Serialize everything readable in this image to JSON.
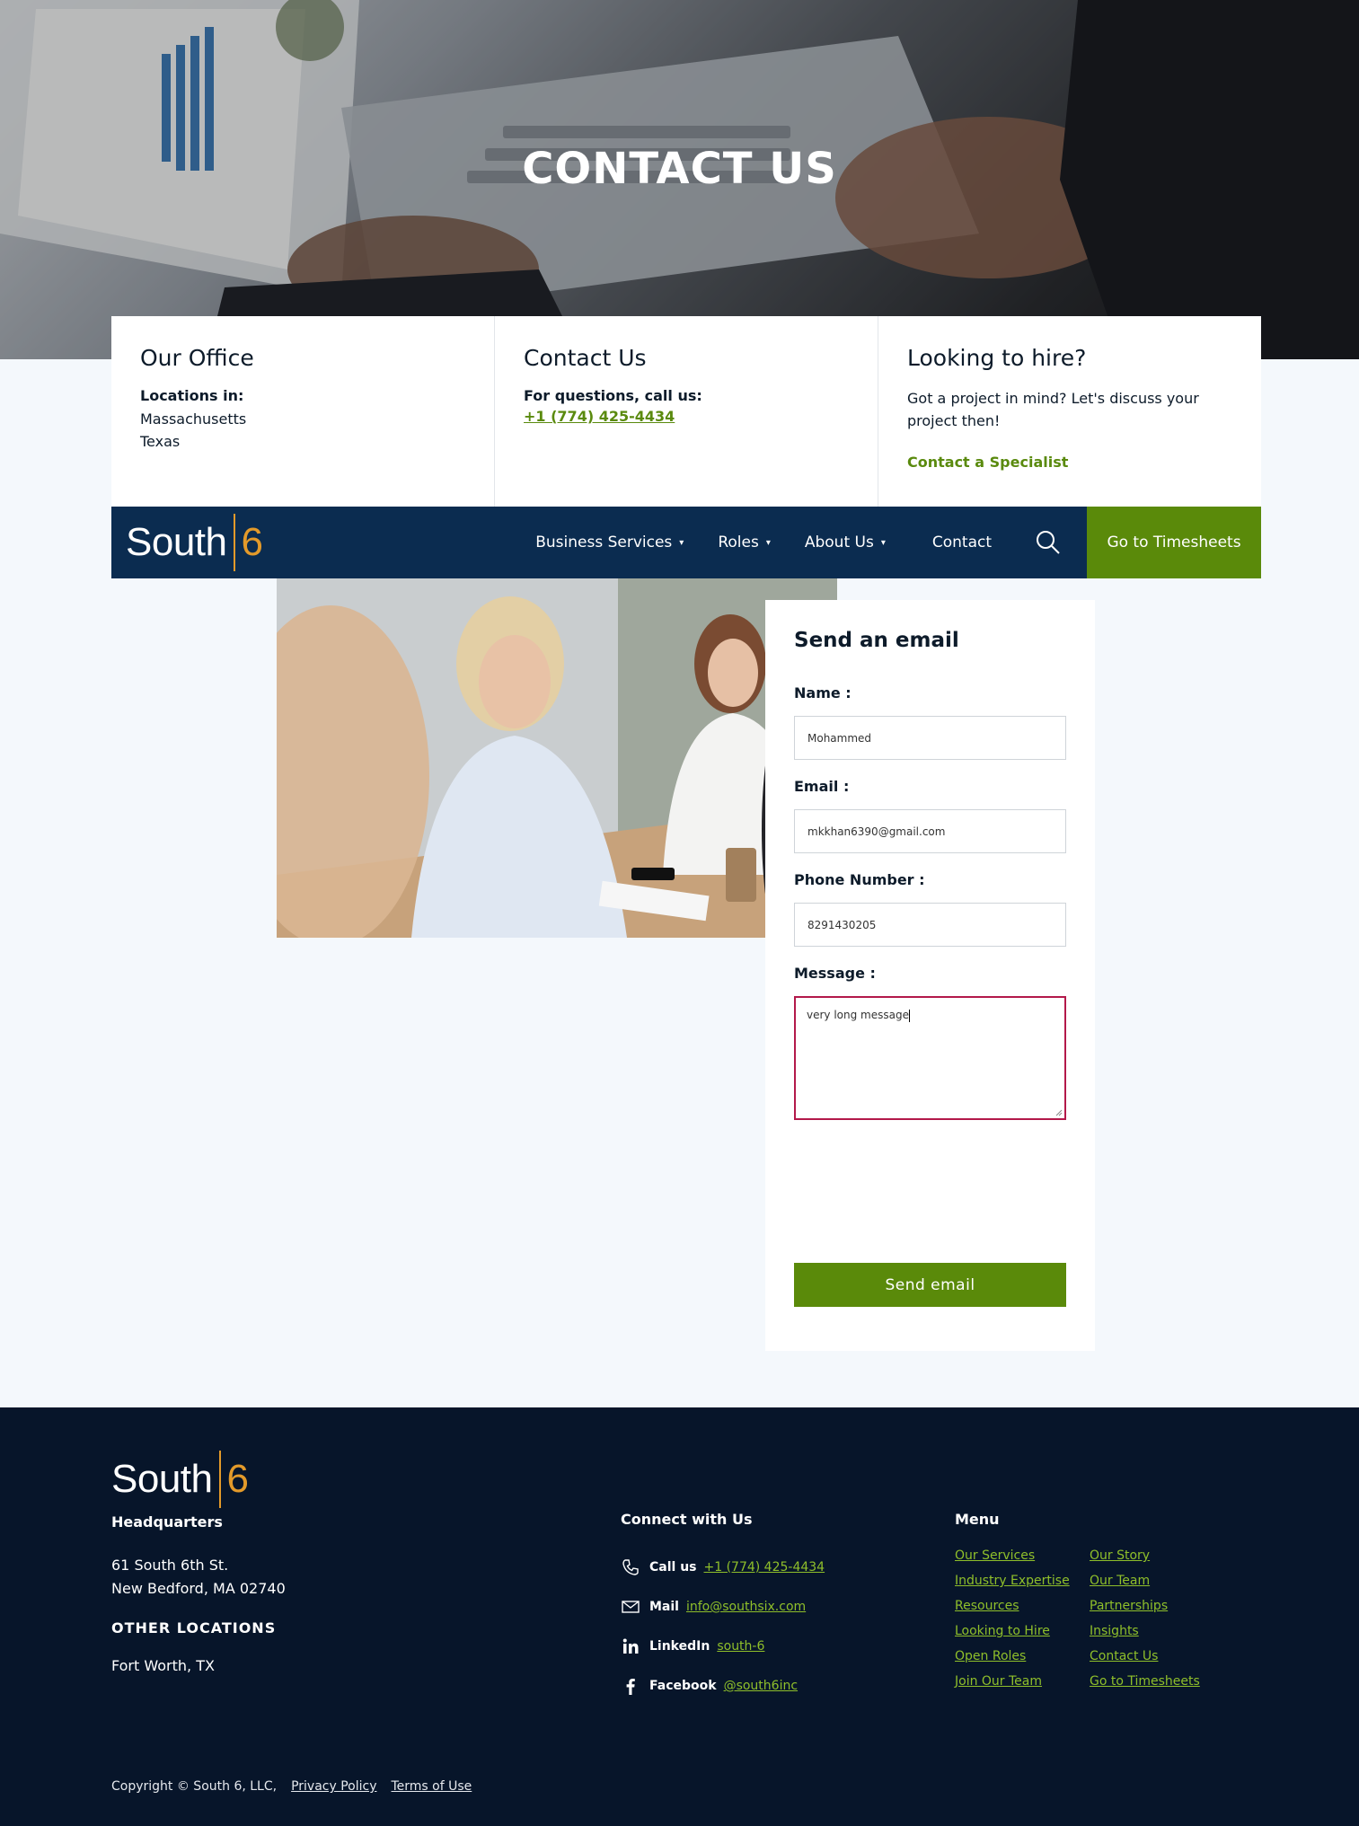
{
  "hero": {
    "title": "CONTACT US"
  },
  "cards": {
    "office": {
      "heading": "Our Office",
      "label": "Locations in:",
      "lines": [
        "Massachusetts",
        "Texas"
      ]
    },
    "contact": {
      "heading": "Contact Us",
      "label": "For questions, call us:",
      "phone": "+1 (774) 425-4434"
    },
    "hire": {
      "heading": "Looking to hire?",
      "text": "Got a project in mind? Let's discuss your project then!",
      "cta": "Contact a Specialist"
    }
  },
  "nav": {
    "logo_text": "South",
    "logo_num": "6",
    "items": [
      {
        "label": "Business Services",
        "dropdown": true
      },
      {
        "label": "Roles",
        "dropdown": true
      },
      {
        "label": "About Us",
        "dropdown": true
      },
      {
        "label": "Contact",
        "dropdown": false
      }
    ],
    "caret": "▾",
    "search_icon": "search-icon",
    "timesheets": "Go to Timesheets"
  },
  "form": {
    "title": "Send an email",
    "name_label": "Name :",
    "name_value": "Mohammed",
    "email_label": "Email :",
    "email_value": "mkkhan6390@gmail.com",
    "phone_label": "Phone Number :",
    "phone_value": "8291430205",
    "message_label": "Message :",
    "message_value": "very long message",
    "submit": "Send email"
  },
  "footer": {
    "logo_text": "South",
    "logo_num": "6",
    "hq_heading": "Headquarters",
    "hq_line1": "61 South 6th St.",
    "hq_line2": "New Bedford, MA 02740",
    "other_heading": "OTHER LOCATIONS",
    "other_line": "Fort Worth, TX",
    "connect_heading": "Connect with Us",
    "connect": [
      {
        "icon": "phone-icon",
        "label": "Call us",
        "value": "+1 (774) 425-4434"
      },
      {
        "icon": "mail-icon",
        "label": "Mail",
        "value": "info@southsix.com"
      },
      {
        "icon": "linkedin-icon",
        "label": "LinkedIn",
        "value": "south-6"
      },
      {
        "icon": "facebook-icon",
        "label": "Facebook",
        "value": "@south6inc"
      }
    ],
    "menu_heading": "Menu",
    "menu": [
      "Our Services",
      "Our Story",
      "Industry Expertise",
      "Our Team",
      "Resources",
      "Partnerships",
      "Looking to Hire",
      "Insights",
      "Open Roles",
      "Contact Us",
      "Join Our Team",
      "Go to Timesheets"
    ],
    "copyright": "Copyright © South 6, LLC,",
    "privacy": "Privacy Policy",
    "terms": "Terms of Use"
  },
  "colors": {
    "navy": "#0b2c50",
    "green": "#5a8a0a",
    "accent": "#e39a2a",
    "footer": "#07152a",
    "link": "#8fbf2a",
    "error": "#b3194a"
  }
}
